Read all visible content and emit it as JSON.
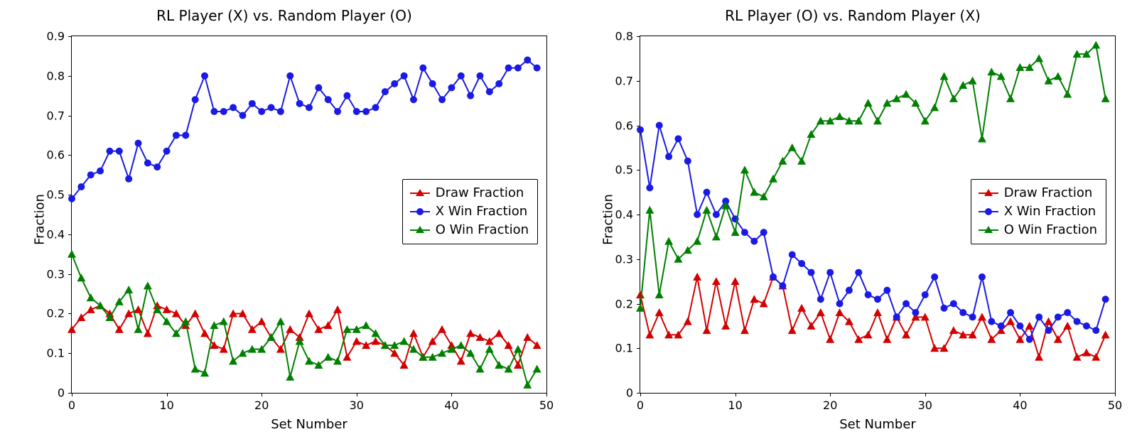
{
  "chart_data": [
    {
      "type": "line",
      "title": "RL Player (X) vs. Random Player (O)",
      "xlabel": "Set Number",
      "ylabel": "Fraction",
      "xlim": [
        0,
        50
      ],
      "ylim": [
        0.0,
        0.9
      ],
      "xticks": [
        0,
        10,
        20,
        30,
        40,
        50
      ],
      "yticks": [
        0.0,
        0.1,
        0.2,
        0.3,
        0.4,
        0.5,
        0.6,
        0.7,
        0.8,
        0.9
      ],
      "x": [
        0,
        1,
        2,
        3,
        4,
        5,
        6,
        7,
        8,
        9,
        10,
        11,
        12,
        13,
        14,
        15,
        16,
        17,
        18,
        19,
        20,
        21,
        22,
        23,
        24,
        25,
        26,
        27,
        28,
        29,
        30,
        31,
        32,
        33,
        34,
        35,
        36,
        37,
        38,
        39,
        40,
        41,
        42,
        43,
        44,
        45,
        46,
        47,
        48,
        49
      ],
      "legend_position": "right-center",
      "series": [
        {
          "name": "Draw Fraction",
          "marker": "triangle",
          "color": "#d40000",
          "values": [
            0.16,
            0.19,
            0.21,
            0.22,
            0.2,
            0.16,
            0.2,
            0.21,
            0.15,
            0.22,
            0.21,
            0.2,
            0.17,
            0.2,
            0.15,
            0.12,
            0.11,
            0.2,
            0.2,
            0.16,
            0.18,
            0.14,
            0.11,
            0.16,
            0.14,
            0.2,
            0.16,
            0.17,
            0.21,
            0.09,
            0.13,
            0.12,
            0.13,
            0.12,
            0.1,
            0.07,
            0.15,
            0.09,
            0.13,
            0.16,
            0.12,
            0.08,
            0.15,
            0.14,
            0.13,
            0.15,
            0.12,
            0.07,
            0.14,
            0.12
          ]
        },
        {
          "name": "X Win Fraction",
          "marker": "circle",
          "color": "#1a1ae6",
          "values": [
            0.49,
            0.52,
            0.55,
            0.56,
            0.61,
            0.61,
            0.54,
            0.63,
            0.58,
            0.57,
            0.61,
            0.65,
            0.65,
            0.74,
            0.8,
            0.71,
            0.71,
            0.72,
            0.7,
            0.73,
            0.71,
            0.72,
            0.71,
            0.8,
            0.73,
            0.72,
            0.77,
            0.74,
            0.71,
            0.75,
            0.71,
            0.71,
            0.72,
            0.76,
            0.78,
            0.8,
            0.74,
            0.82,
            0.78,
            0.74,
            0.77,
            0.8,
            0.75,
            0.8,
            0.76,
            0.78,
            0.82,
            0.82,
            0.84,
            0.82
          ]
        },
        {
          "name": "O Win Fraction",
          "marker": "triangle",
          "color": "#008000",
          "values": [
            0.35,
            0.29,
            0.24,
            0.22,
            0.19,
            0.23,
            0.26,
            0.16,
            0.27,
            0.21,
            0.18,
            0.15,
            0.18,
            0.06,
            0.05,
            0.17,
            0.18,
            0.08,
            0.1,
            0.11,
            0.11,
            0.14,
            0.18,
            0.04,
            0.13,
            0.08,
            0.07,
            0.09,
            0.08,
            0.16,
            0.16,
            0.17,
            0.15,
            0.12,
            0.12,
            0.13,
            0.11,
            0.09,
            0.09,
            0.1,
            0.11,
            0.12,
            0.1,
            0.06,
            0.11,
            0.07,
            0.06,
            0.11,
            0.02,
            0.06
          ]
        }
      ]
    },
    {
      "type": "line",
      "title": "RL Player (O) vs. Random Player (X)",
      "xlabel": "Set Number",
      "ylabel": "Fraction",
      "xlim": [
        0,
        50
      ],
      "ylim": [
        0.0,
        0.8
      ],
      "xticks": [
        0,
        10,
        20,
        30,
        40,
        50
      ],
      "yticks": [
        0.0,
        0.1,
        0.2,
        0.3,
        0.4,
        0.5,
        0.6,
        0.7,
        0.8
      ],
      "x": [
        0,
        1,
        2,
        3,
        4,
        5,
        6,
        7,
        8,
        9,
        10,
        11,
        12,
        13,
        14,
        15,
        16,
        17,
        18,
        19,
        20,
        21,
        22,
        23,
        24,
        25,
        26,
        27,
        28,
        29,
        30,
        31,
        32,
        33,
        34,
        35,
        36,
        37,
        38,
        39,
        40,
        41,
        42,
        43,
        44,
        45,
        46,
        47,
        48,
        49
      ],
      "legend_position": "right-center",
      "series": [
        {
          "name": "Draw Fraction",
          "marker": "triangle",
          "color": "#d40000",
          "values": [
            0.22,
            0.13,
            0.18,
            0.13,
            0.13,
            0.16,
            0.26,
            0.14,
            0.25,
            0.15,
            0.25,
            0.14,
            0.21,
            0.2,
            0.26,
            0.24,
            0.14,
            0.19,
            0.15,
            0.18,
            0.12,
            0.18,
            0.16,
            0.12,
            0.13,
            0.18,
            0.12,
            0.17,
            0.13,
            0.17,
            0.17,
            0.1,
            0.1,
            0.14,
            0.13,
            0.13,
            0.17,
            0.12,
            0.14,
            0.16,
            0.12,
            0.15,
            0.08,
            0.16,
            0.12,
            0.15,
            0.08,
            0.09,
            0.08,
            0.13
          ]
        },
        {
          "name": "X Win Fraction",
          "marker": "circle",
          "color": "#1a1ae6",
          "values": [
            0.59,
            0.46,
            0.6,
            0.53,
            0.57,
            0.52,
            0.4,
            0.45,
            0.4,
            0.43,
            0.39,
            0.36,
            0.34,
            0.36,
            0.26,
            0.24,
            0.31,
            0.29,
            0.27,
            0.21,
            0.27,
            0.2,
            0.23,
            0.27,
            0.22,
            0.21,
            0.23,
            0.17,
            0.2,
            0.18,
            0.22,
            0.26,
            0.19,
            0.2,
            0.18,
            0.17,
            0.26,
            0.16,
            0.15,
            0.18,
            0.15,
            0.12,
            0.17,
            0.14,
            0.17,
            0.18,
            0.16,
            0.15,
            0.14,
            0.21
          ]
        },
        {
          "name": "O Win Fraction",
          "marker": "triangle",
          "color": "#008000",
          "values": [
            0.19,
            0.41,
            0.22,
            0.34,
            0.3,
            0.32,
            0.34,
            0.41,
            0.35,
            0.42,
            0.36,
            0.5,
            0.45,
            0.44,
            0.48,
            0.52,
            0.55,
            0.52,
            0.58,
            0.61,
            0.61,
            0.62,
            0.61,
            0.61,
            0.65,
            0.61,
            0.65,
            0.66,
            0.67,
            0.65,
            0.61,
            0.64,
            0.71,
            0.66,
            0.69,
            0.7,
            0.57,
            0.72,
            0.71,
            0.66,
            0.73,
            0.73,
            0.75,
            0.7,
            0.71,
            0.67,
            0.76,
            0.76,
            0.78,
            0.66
          ]
        }
      ]
    }
  ]
}
